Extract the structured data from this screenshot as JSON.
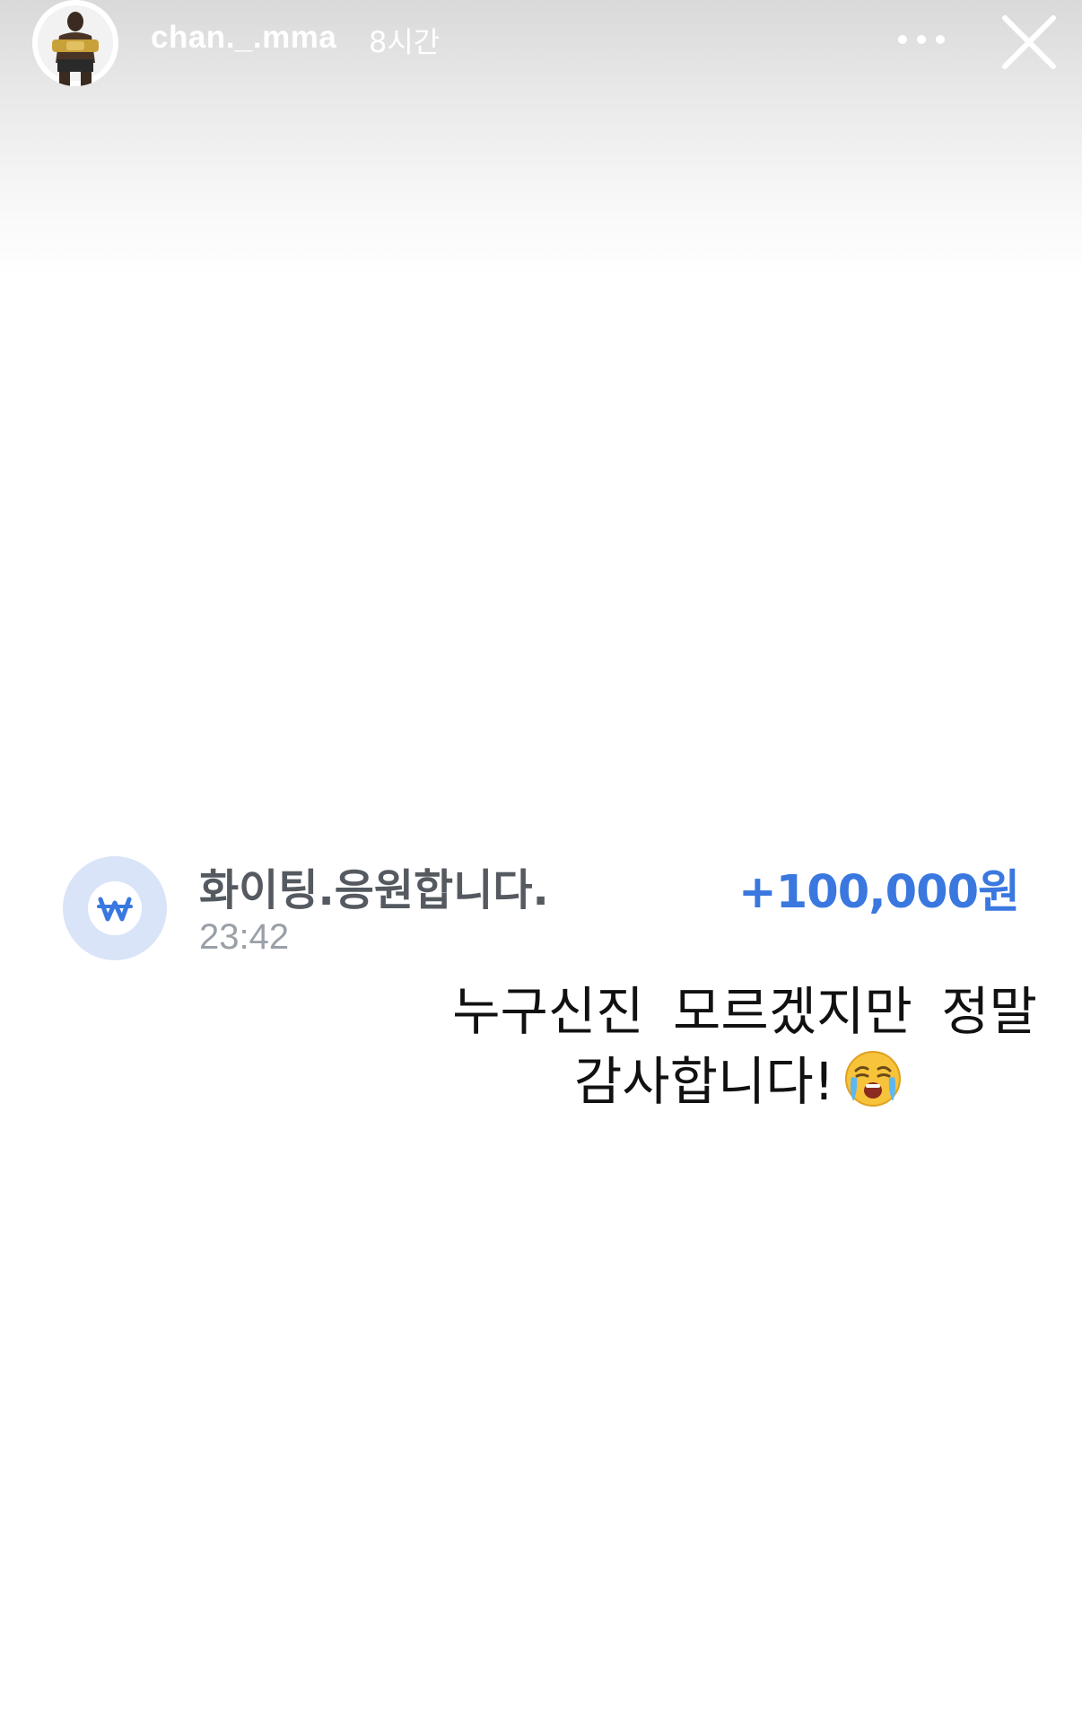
{
  "header": {
    "username": "chan._.mma",
    "time_ago": "8시간",
    "avatar_icon": "profile-avatar",
    "more_icon": "ellipsis-icon",
    "close_icon": "close-icon"
  },
  "transaction": {
    "icon": "won-icon",
    "icon_symbol": "₩",
    "title": "화이팅.응원합니다.",
    "time": "23:42",
    "amount": "+100,000원"
  },
  "caption": {
    "line1": "누구신진 모르겠지만 정말",
    "line2": "감사합니다!",
    "emoji": "crying-face-emoji"
  },
  "colors": {
    "amount": "#3a78e0",
    "icon_bg": "#d9e4f9",
    "title": "#555a61",
    "time": "#9aa0a8"
  }
}
